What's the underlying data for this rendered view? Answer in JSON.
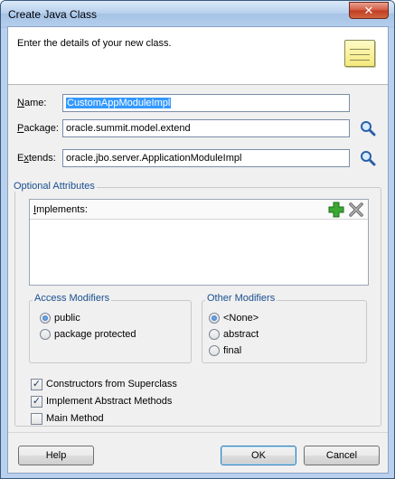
{
  "window": {
    "title": "Create Java Class",
    "close_glyph": "✕"
  },
  "header": {
    "instruction": "Enter the details of your new class.",
    "icon": "java-class-note-icon"
  },
  "fields": {
    "name": {
      "label_prefix": "",
      "label_mnemonic": "N",
      "label_rest": "ame:",
      "value": "CustomAppModuleImpl"
    },
    "package": {
      "label_mnemonic": "P",
      "label_rest": "ackage:",
      "value": "oracle.summit.model.extend"
    },
    "extends": {
      "label_prefix": "E",
      "label_mnemonic": "x",
      "label_rest": "tends:",
      "value": "oracle.jbo.server.ApplicationModuleImpl"
    }
  },
  "optional_attributes": {
    "legend": "Optional Attributes",
    "implements_label_mnemonic": "I",
    "implements_label_rest": "mplements:",
    "add_icon": "plus-icon",
    "remove_icon": "remove-x-icon"
  },
  "access_modifiers": {
    "legend": "Access Modifiers",
    "options": [
      {
        "label": "public",
        "selected": true
      },
      {
        "label": "package protected",
        "selected": false
      }
    ]
  },
  "other_modifiers": {
    "legend": "Other Modifiers",
    "options": [
      {
        "label": "<None>",
        "selected": true
      },
      {
        "label": "abstract",
        "selected": false
      },
      {
        "label": "final",
        "selected": false
      }
    ]
  },
  "checkboxes": [
    {
      "label": "Constructors from Superclass",
      "checked": true
    },
    {
      "label": "Implement Abstract Methods",
      "checked": true
    },
    {
      "label": "Main Method",
      "checked": false
    }
  ],
  "buttons": {
    "help": "Help",
    "ok": "OK",
    "cancel": "Cancel"
  },
  "check_glyph": "✓",
  "colors": {
    "legend_text": "#1a4f8f",
    "selection": "#3399ff",
    "add_icon_green": "#3aa832"
  }
}
